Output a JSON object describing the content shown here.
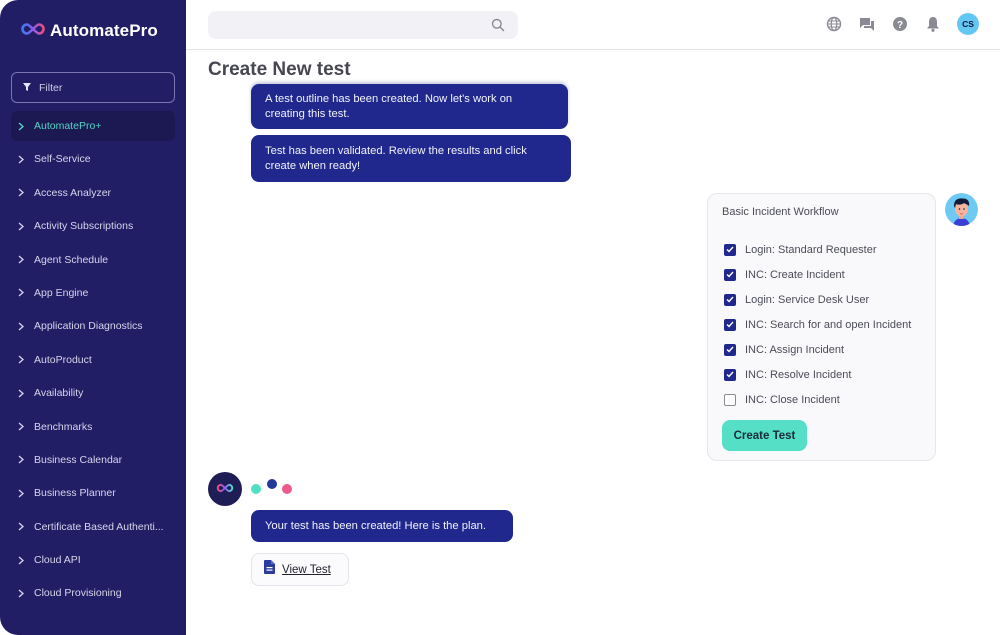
{
  "app": {
    "name": "AutomatePro"
  },
  "sidebar": {
    "filter_placeholder": "Filter",
    "items": [
      {
        "label": "AutomatePro+",
        "active": true
      },
      {
        "label": "Self-Service"
      },
      {
        "label": "Access Analyzer"
      },
      {
        "label": "Activity Subscriptions"
      },
      {
        "label": "Agent Schedule"
      },
      {
        "label": "App Engine"
      },
      {
        "label": "Application Diagnostics"
      },
      {
        "label": "AutoProduct"
      },
      {
        "label": "Availability"
      },
      {
        "label": "Benchmarks"
      },
      {
        "label": "Business Calendar"
      },
      {
        "label": "Business Planner"
      },
      {
        "label": "Certificate Based Authenti..."
      },
      {
        "label": "Cloud API"
      },
      {
        "label": "Cloud Provisioning"
      }
    ]
  },
  "topbar": {
    "search_value": "",
    "icons": [
      "globe-icon",
      "chat-icon",
      "help-icon",
      "bell-icon"
    ],
    "user_initials": "CS"
  },
  "page": {
    "title": "Create New test"
  },
  "chat": {
    "messages": [
      "A test outline has been created. Now let's work on creating this test.",
      "Test has been validated. Review the results and click create when ready!",
      "Your test has been created! Here is the plan."
    ],
    "view_test_label": "View Test"
  },
  "workflow": {
    "title": "Basic Incident Workflow",
    "steps": [
      {
        "label": "Login: Standard Requester",
        "checked": true
      },
      {
        "label": "INC: Create Incident",
        "checked": true
      },
      {
        "label": "Login: Service Desk User",
        "checked": true
      },
      {
        "label": "INC: Search for and open Incident",
        "checked": true
      },
      {
        "label": "INC: Assign Incident",
        "checked": true
      },
      {
        "label": "INC: Resolve Incident",
        "checked": true
      },
      {
        "label": "INC: Close Incident",
        "checked": false
      }
    ],
    "create_button_label": "Create Test"
  },
  "colors": {
    "sidebar_bg": "#221e66",
    "accent_teal": "#55dfc6",
    "bubble_blue": "#20288e",
    "active_text": "#52d6c2"
  }
}
